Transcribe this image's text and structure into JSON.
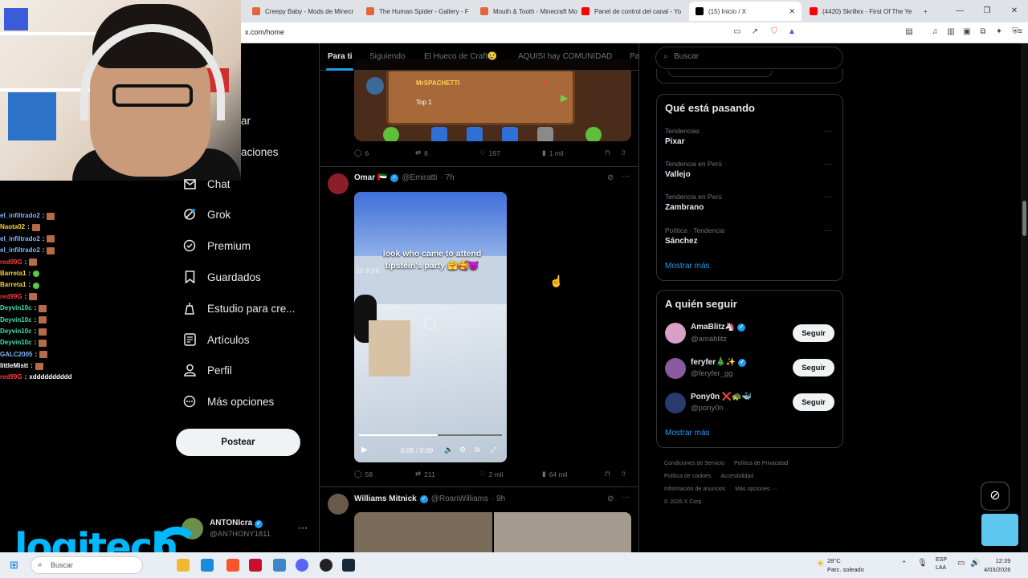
{
  "browser": {
    "tabs": [
      {
        "title": "Creepy Baby - Mods de Minecr",
        "color": "#e0673a"
      },
      {
        "title": "The Human Spider - Gallery - F",
        "color": "#e0673a"
      },
      {
        "title": "Mouth & Tooth - Minecraft Mo",
        "color": "#e0673a"
      },
      {
        "title": "Panel de control del canal - Yo",
        "color": "#ff0000"
      },
      {
        "title": "(15) Inicio / X",
        "color": "#000000"
      },
      {
        "title": "(4420) Skrillex - First Of The Ye",
        "color": "#ff0000"
      }
    ],
    "url": "x.com/home"
  },
  "chat": [
    {
      "user": "el_infiltrado2",
      "color": "#7fb8ff",
      "emote": "block"
    },
    {
      "user": "Naota02",
      "color": "#f5d33c",
      "emote": "block"
    },
    {
      "user": "el_infiltrado2",
      "color": "#7fb8ff",
      "emote": "block"
    },
    {
      "user": "el_infiltrado2",
      "color": "#7fb8ff",
      "emote": "block"
    },
    {
      "user": "red99G",
      "color": "#ff3b3b",
      "emote": "block"
    },
    {
      "user": "Barreta1",
      "color": "#f5d33c",
      "emote": "green"
    },
    {
      "user": "Barreta1",
      "color": "#f5d33c",
      "emote": "green"
    },
    {
      "user": "red99G",
      "color": "#ff3b3b",
      "emote": "block"
    },
    {
      "user": "Deyvin10c",
      "color": "#41e0b5",
      "emote": "block"
    },
    {
      "user": "Deyvin10c",
      "color": "#41e0b5",
      "emote": "block"
    },
    {
      "user": "Deyvin10c",
      "color": "#41e0b5",
      "emote": "block"
    },
    {
      "user": "Deyvin10c",
      "color": "#41e0b5",
      "emote": "block"
    },
    {
      "user": "GALC2005",
      "color": "#7fb8ff",
      "emote": "block"
    },
    {
      "user": "littleMistt",
      "color": "#ffffff",
      "emote": "block"
    },
    {
      "user": "red99G",
      "color": "#ff3b3b",
      "text": "xdddddddddd"
    }
  ],
  "nav": {
    "partial_items": [
      "ar",
      "aciones"
    ],
    "items": [
      {
        "label": "Chat",
        "icon": "mail-icon"
      },
      {
        "label": "Grok",
        "icon": "grok-icon"
      },
      {
        "label": "Premium",
        "icon": "premium-icon"
      },
      {
        "label": "Guardados",
        "icon": "bookmark-icon"
      },
      {
        "label": "Estudio para cre...",
        "icon": "creator-studio-icon"
      },
      {
        "label": "Artículos",
        "icon": "articles-icon"
      },
      {
        "label": "Perfil",
        "icon": "profile-icon"
      },
      {
        "label": "Más opciones",
        "icon": "more-options-icon"
      }
    ],
    "post_label": "Postear",
    "profile": {
      "name": "ANTONIcra",
      "handle": "@AN7HONY1811",
      "more": "···"
    }
  },
  "feed": {
    "tabs": [
      "Para ti",
      "Siguiendo",
      "El Hueco de Craft😢",
      "AQUISI hay COMUNIDAD",
      "Pa"
    ],
    "game_card": {
      "title": "MrSPACHETTI",
      "subtitle": "Top 1"
    },
    "post1_actions": {
      "replies": "6",
      "reposts": "8",
      "likes": "197",
      "views": "1 mil"
    },
    "post2": {
      "name": "Omar 🇦🇪",
      "handle": "@Emiratti",
      "time": "· 7h",
      "video_caption": "look who came to attend tipstein's party 🤗🥰😈",
      "video_overlay": "lie Kirk",
      "video_time": "0:05 / 0:09",
      "video_progress": 0.55,
      "actions": {
        "replies": "58",
        "reposts": "211",
        "likes": "2 mil",
        "views": "64 mil"
      }
    },
    "post3": {
      "name": "Williams Mitnick",
      "handle": "@RoanWilliams",
      "time": "· 9h"
    }
  },
  "right": {
    "search_placeholder": "Buscar",
    "trends_title": "Qué está pasando",
    "trends": [
      {
        "context": "Tendencias",
        "name": "Pixar"
      },
      {
        "context": "Tendencia en Perú",
        "name": "Vallejo"
      },
      {
        "context": "Tendencia en Perú",
        "name": "Zambrano"
      },
      {
        "context": "Política · Tendencia",
        "name": "Sánchez"
      }
    ],
    "show_more": "Mostrar más",
    "follow_title": "A quién seguir",
    "follow": [
      {
        "name": "AmaBlitz🦄",
        "handle": "@amablitz",
        "color": "#d9a0c6"
      },
      {
        "name": "feryfer🎄✨",
        "handle": "@feryfer_gg",
        "color": "#8a5a9e"
      },
      {
        "name": "Pony0n ❌🐢🐳",
        "handle": "@pony0n",
        "color": "#2a3a6a"
      }
    ],
    "follow_button": "Seguir",
    "footer": [
      "Condiciones de Servicio",
      "Política de Privacidad",
      "Política de cookies",
      "Accesibilidad",
      "Información de anuncios",
      "Más opciones ···",
      "© 2026 X Corp."
    ]
  },
  "taskbar": {
    "search_placeholder": "Buscar",
    "weather_temp": "28°C",
    "weather_desc": "Parc. soleado",
    "lang": "ESP",
    "lang2": "LAA",
    "time": "12:39",
    "date": "4/03/2026"
  },
  "overlay": {
    "brand": "logitech"
  },
  "colors": {
    "accent": "#1d9bf0",
    "bg": "#000000",
    "muted": "#71767b",
    "border": "#2f3336"
  }
}
